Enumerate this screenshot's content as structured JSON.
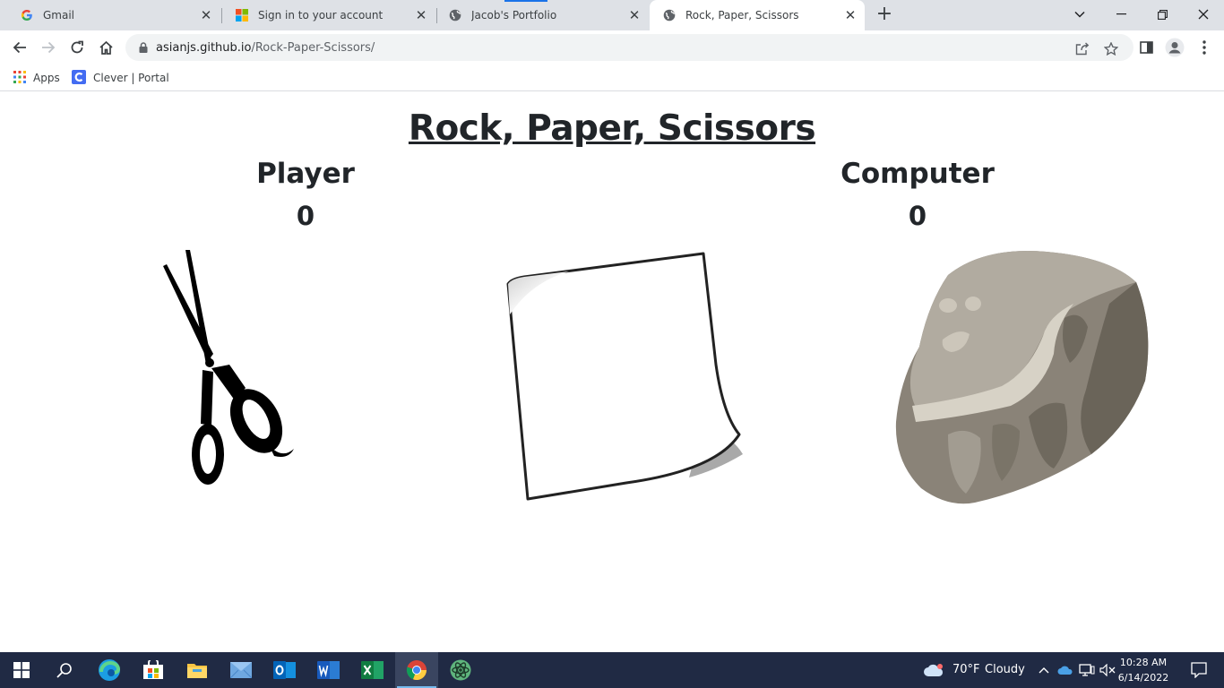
{
  "browser": {
    "tabs": [
      {
        "title": "Gmail",
        "icon": "google-g-icon"
      },
      {
        "title": "Sign in to your account",
        "icon": "microsoft-icon"
      },
      {
        "title": "Jacob's Portfolio",
        "icon": "globe-icon"
      },
      {
        "title": "Rock, Paper, Scissors",
        "icon": "globe-icon",
        "active": true
      }
    ],
    "new_tab": "+",
    "address": {
      "host": "asianjs.github.io",
      "path": "/Rock-Paper-Scissors/"
    },
    "bookmarks": [
      {
        "label": "Apps",
        "icon": "apps-grid-icon"
      },
      {
        "label": "Clever | Portal",
        "icon": "clever-icon"
      }
    ]
  },
  "game": {
    "title": "Rock, Paper, Scissors",
    "player": {
      "label": "Player",
      "score": "0"
    },
    "computer": {
      "label": "Computer",
      "score": "0"
    },
    "choices": [
      "scissors",
      "paper",
      "rock"
    ]
  },
  "taskbar": {
    "weather": {
      "temp": "70°F",
      "condition": "Cloudy"
    },
    "time": "10:28 AM",
    "date": "6/14/2022",
    "apps": [
      "start",
      "search",
      "edge",
      "store",
      "file-explorer",
      "mail",
      "outlook",
      "word",
      "excel",
      "chrome",
      "atom"
    ]
  },
  "colors": {
    "tab_bg": "#dee1e6",
    "taskbar_bg": "#202a44",
    "text": "#212529"
  }
}
